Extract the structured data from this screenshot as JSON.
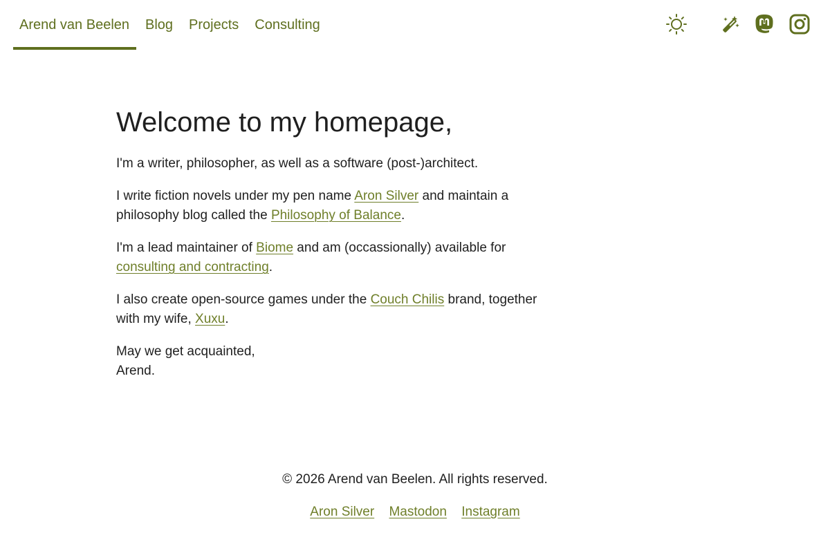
{
  "nav": {
    "items": [
      {
        "label": "Arend van Beelen",
        "active": true
      },
      {
        "label": "Blog",
        "active": false
      },
      {
        "label": "Projects",
        "active": false
      },
      {
        "label": "Consulting",
        "active": false
      }
    ]
  },
  "header_icons": [
    "sun-icon",
    "magic-wand-icon",
    "mastodon-icon",
    "instagram-icon"
  ],
  "colors": {
    "accent": "#5f6f1f",
    "link": "#6f7f2a",
    "text": "#1f1f1f",
    "background": "#ffffff"
  },
  "main": {
    "heading": "Welcome to my homepage,",
    "p1": "I'm a writer, philosopher, as well as a software (post-)architect.",
    "p2": {
      "before": "I write fiction novels under my pen name ",
      "link1": "Aron Silver",
      "middle": " and maintain a philosophy blog called the ",
      "link2": "Philosophy of Balance",
      "after": "."
    },
    "p3": {
      "before": "I'm a lead maintainer of ",
      "link1": "Biome",
      "middle": " and am (occassionally) available for ",
      "link2": "consulting and contracting",
      "after": "."
    },
    "p4": {
      "before": "I also create open-source games under the ",
      "link1": "Couch Chilis",
      "middle": " brand, together with my wife, ",
      "link2": "Xuxu",
      "after": "."
    },
    "p5": {
      "line1": "May we get acquainted,",
      "line2": "Arend."
    }
  },
  "footer": {
    "copyright": "© 2026 Arend van Beelen. All rights reserved.",
    "links": [
      "Aron Silver",
      "Mastodon",
      "Instagram"
    ]
  }
}
